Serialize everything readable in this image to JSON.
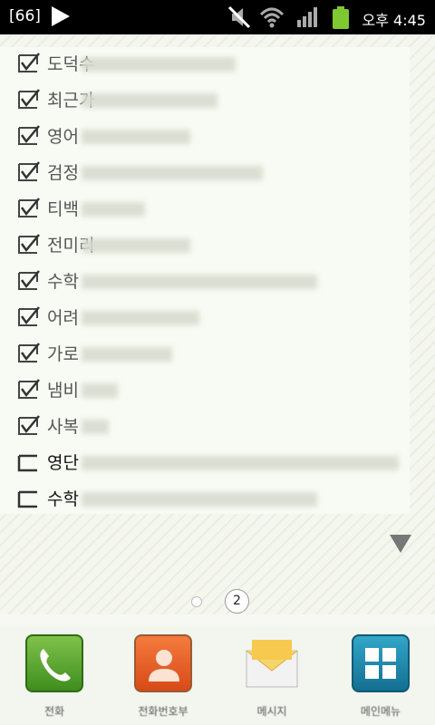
{
  "status_bar": {
    "notification_badge": "[66]",
    "time": "오후 4:45"
  },
  "memo": {
    "items": [
      {
        "label": "도덕수",
        "checked": true
      },
      {
        "label": "최근가",
        "checked": true
      },
      {
        "label": "영어",
        "checked": true
      },
      {
        "label": "검정",
        "checked": true
      },
      {
        "label": "티백",
        "checked": true
      },
      {
        "label": "전미리",
        "checked": true
      },
      {
        "label": "수학",
        "checked": true
      },
      {
        "label": "어려",
        "checked": true
      },
      {
        "label": "가로",
        "checked": true
      },
      {
        "label": "냄비",
        "checked": true
      },
      {
        "label": "사복",
        "checked": true
      },
      {
        "label": "영단",
        "checked": false
      },
      {
        "label": "수학",
        "checked": false
      }
    ]
  },
  "pager": {
    "current_page": "2"
  },
  "dock": {
    "items": [
      {
        "label": "전화",
        "icon": "phone-icon"
      },
      {
        "label": "전화번호부",
        "icon": "contacts-icon"
      },
      {
        "label": "메시지",
        "icon": "message-icon"
      },
      {
        "label": "메인메뉴",
        "icon": "apps-icon"
      }
    ]
  }
}
